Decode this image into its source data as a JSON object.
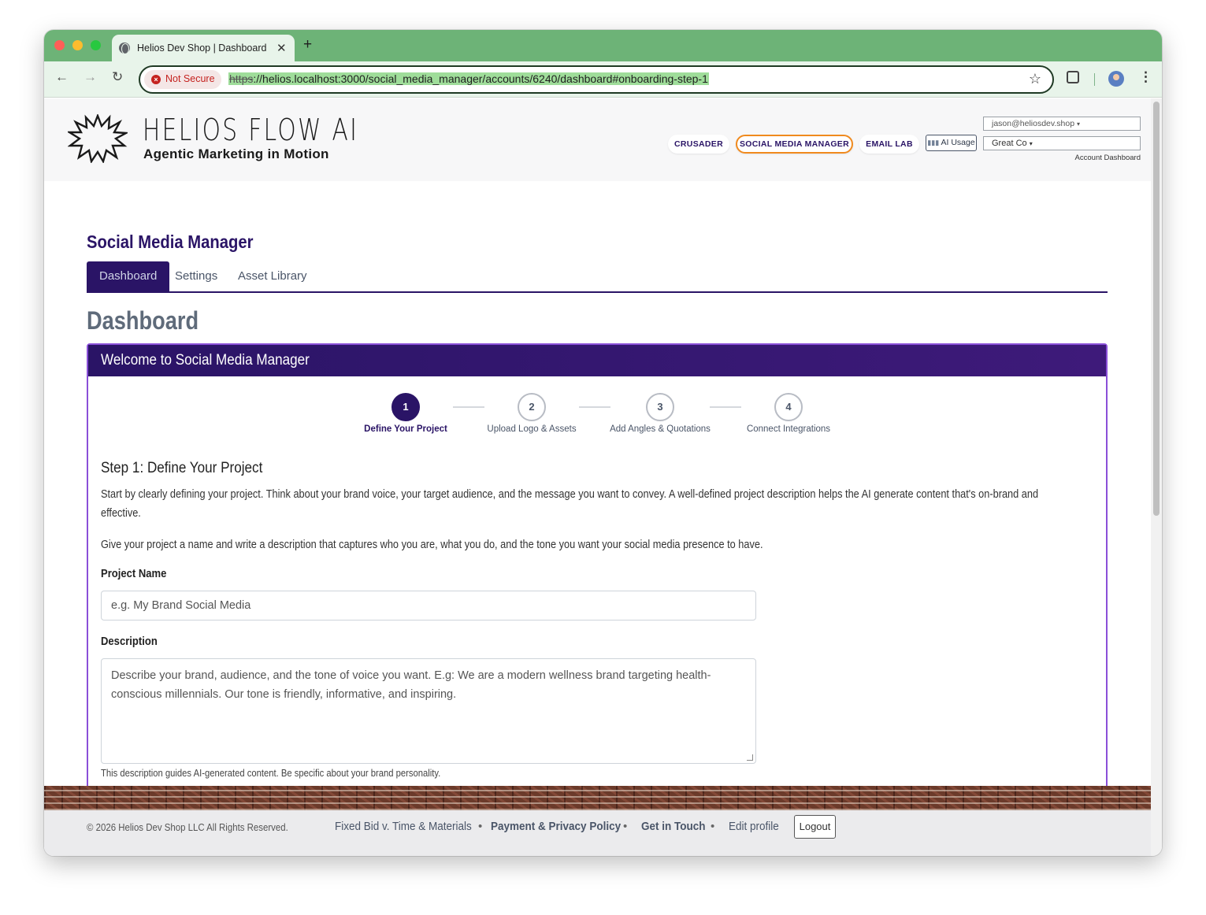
{
  "browser": {
    "tab_title": "Helios Dev Shop | Dashboard",
    "tab_close": "✕",
    "new_tab": "+",
    "security_label": "Not Secure",
    "url_scheme": "https",
    "url_rest": "://helios.localhost:3000/social_media_manager/accounts/6240/dashboard#onboarding-step-1",
    "icons": [
      "back-arrow-icon",
      "forward-arrow-icon",
      "reload-icon",
      "star-icon",
      "extensions-icon",
      "profile-avatar",
      "more-menu-icon"
    ]
  },
  "header": {
    "brand_name": "HELIOS FLOW AI",
    "brand_tagline": "Agentic Marketing in Motion",
    "nav": [
      {
        "label": "CRUSADER",
        "active": false
      },
      {
        "label": "SOCIAL MEDIA MANAGER",
        "active": true
      },
      {
        "label": "EMAIL LAB",
        "active": false
      }
    ],
    "ai_usage_label": "AI Usage",
    "user_email": "jason@heliosdev.shop",
    "account_name": "Great Co",
    "account_dashboard_link": "Account Dashboard",
    "accent_color": "#f08a1e"
  },
  "main": {
    "app_title": "Social Media Manager",
    "tabs": [
      {
        "label": "Dashboard",
        "active": true
      },
      {
        "label": "Settings",
        "active": false
      },
      {
        "label": "Asset Library",
        "active": false
      }
    ],
    "page_heading": "Dashboard",
    "card": {
      "title": "Welcome to Social Media Manager",
      "steps": [
        {
          "number": "1",
          "label": "Define Your Project",
          "active": true
        },
        {
          "number": "2",
          "label": "Upload Logo & Assets",
          "active": false
        },
        {
          "number": "3",
          "label": "Add Angles & Quotations",
          "active": false
        },
        {
          "number": "4",
          "label": "Connect Integrations",
          "active": false
        }
      ],
      "step_title": "Step 1: Define Your Project",
      "intro_p1": "Start by clearly defining your project. Think about your brand voice, your target audience, and the message you want to convey. A well-defined project description helps the AI generate content that's on-brand and effective.",
      "intro_p2": "Give your project a name and write a description that captures who you are, what you do, and the tone you want your social media presence to have.",
      "project_name_label": "Project Name",
      "project_name_placeholder": "e.g. My Brand Social Media",
      "description_label": "Description",
      "description_placeholder": "Describe your brand, audience, and the tone of voice you want. E.g: We are a modern wellness brand targeting health-conscious millennials. Our tone is friendly, informative, and inspiring.",
      "description_help": "This description guides AI-generated content. Be specific about your brand personality."
    },
    "brand_color": "#2a1466",
    "card_border_color": "#8a4fd8"
  },
  "footer": {
    "copyright": "© 2026 Helios Dev Shop LLC All Rights Reserved.",
    "links": [
      {
        "label": "Fixed Bid v. Time & Materials",
        "bold": false
      },
      {
        "label": "Payment & Privacy Policy",
        "bold": true
      },
      {
        "label": "Get in Touch",
        "bold": true
      },
      {
        "label": "Edit profile",
        "bold": false
      }
    ],
    "separator": "•",
    "logout_label": "Logout"
  }
}
